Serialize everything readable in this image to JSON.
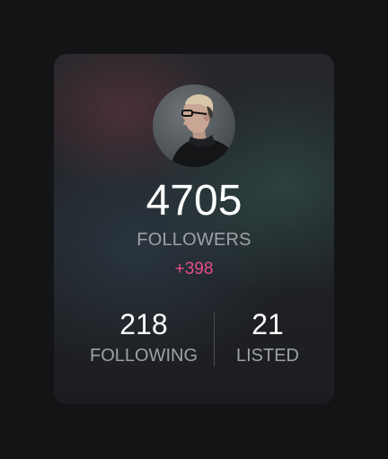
{
  "profile": {
    "avatar_alt": "profile-photo"
  },
  "followers": {
    "count": "4705",
    "label": "FOLLOWERS",
    "delta": "+398"
  },
  "stats": {
    "following": {
      "value": "218",
      "label": "FOLLOWING"
    },
    "listed": {
      "value": "21",
      "label": "LISTED"
    }
  },
  "colors": {
    "background": "#131416",
    "card": "#222428",
    "accent_delta": "#e84d86",
    "label": "#9ea1a6",
    "value": "#ffffff"
  },
  "icons": [
    "avatar"
  ]
}
